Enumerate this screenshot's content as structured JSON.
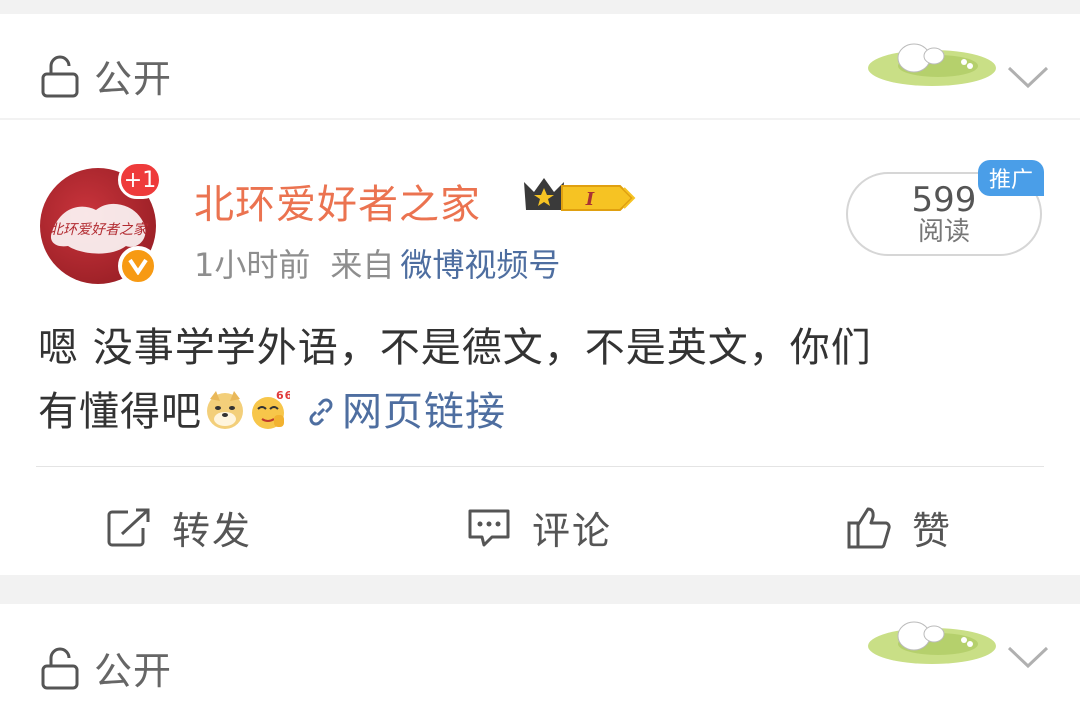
{
  "privacy_top": {
    "label": "公开"
  },
  "post": {
    "author": "北环爱好者之家",
    "avatar_text": "北环爱好者之家",
    "notice_badge": "+1",
    "member_level": "I",
    "time": "1小时前",
    "from_label": "来自",
    "source": "微博视频号",
    "read_count": "599",
    "read_label": "阅读",
    "promo_label": "推广",
    "text_line1": "嗯 没事学学外语，不是德文，不是英文，你们",
    "text_line2": "有懂得吧",
    "link_label": "网页链接",
    "actions": {
      "repost": "转发",
      "comment": "评论",
      "like": "赞"
    }
  },
  "privacy_bottom": {
    "label": "公开"
  },
  "colors": {
    "author": "#eb7350",
    "link": "#4e6ea0",
    "promo": "#4a9ee8",
    "verified": "#f79a13"
  }
}
